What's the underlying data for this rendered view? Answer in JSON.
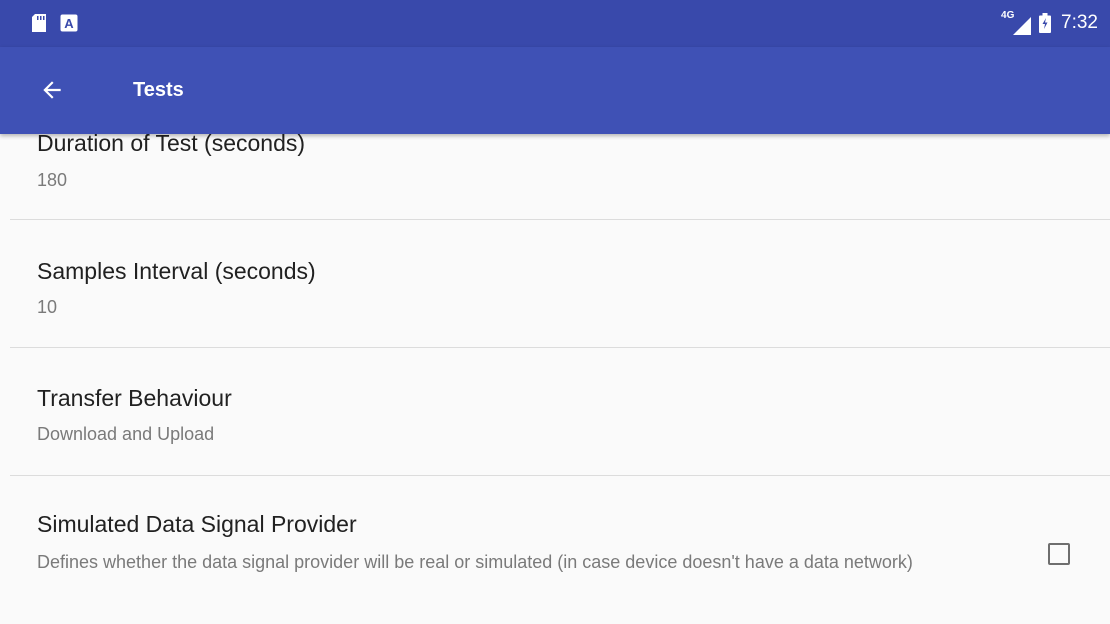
{
  "status_bar": {
    "left_icons": [
      "sd-card-icon",
      "a-notification-icon"
    ],
    "network_type": "4G",
    "right_icons": [
      "signal-icon",
      "battery-icon"
    ],
    "time": "7:32"
  },
  "app_bar": {
    "back_icon": "arrow-back-icon",
    "title": "Tests"
  },
  "preferences": [
    {
      "title": "Duration of Test (seconds)",
      "summary": "180"
    },
    {
      "title": "Samples Interval (seconds)",
      "summary": "10"
    },
    {
      "title": "Transfer Behaviour",
      "summary": "Download and Upload"
    },
    {
      "title": "Simulated Data Signal Provider",
      "summary": "Defines whether the data signal provider will be real or simulated (in case device doesn't have a data network)",
      "checkbox_checked": false
    }
  ],
  "colors": {
    "status_bar": "#3949ab",
    "app_bar": "#3f51b5",
    "background": "#fafafa",
    "title_text": "#212121",
    "summary_text": "#7a7a7a",
    "divider": "#dcdcdc"
  }
}
